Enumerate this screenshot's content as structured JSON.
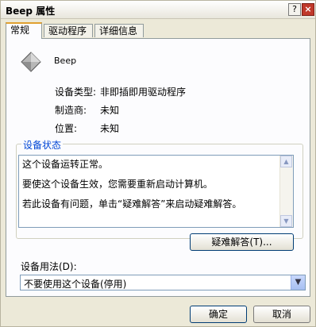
{
  "window": {
    "title": "Beep 属性",
    "help_glyph": "?",
    "close_glyph": "×"
  },
  "tabs": [
    {
      "label": "常规"
    },
    {
      "label": "驱动程序"
    },
    {
      "label": "详细信息"
    }
  ],
  "device": {
    "name": "Beep",
    "icon": "device-diamond-icon",
    "properties": [
      {
        "label": "设备类型:",
        "value": "非即插即用驱动程序"
      },
      {
        "label": "制造商:",
        "value": "未知"
      },
      {
        "label": "位置:",
        "value": "未知"
      }
    ]
  },
  "status": {
    "group_title": "设备状态",
    "lines": [
      "这个设备运转正常。",
      "要使这个设备生效，您需要重新启动计算机。",
      "若此设备有问题，单击“疑难解答”来启动疑难解答。"
    ],
    "troubleshoot_label": "疑难解答(T)..."
  },
  "usage": {
    "label": "设备用法(D):",
    "selected": "不要使用这个设备(停用)"
  },
  "footer": {
    "ok_label": "确定",
    "cancel_label": "取消"
  },
  "colors": {
    "accent": "#0046d5",
    "active_tab": "#e0a030"
  }
}
